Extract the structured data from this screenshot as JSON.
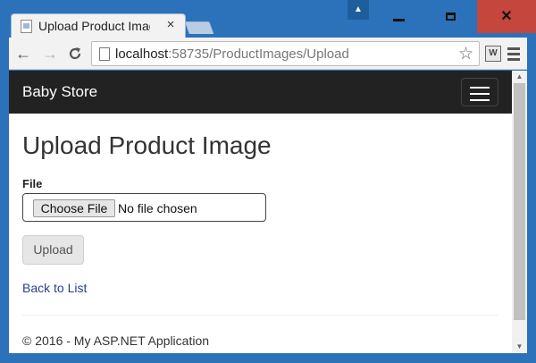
{
  "window": {
    "tab_title": "Upload Product Image",
    "tab_close": "×",
    "user_icon": "person-icon",
    "controls": {
      "minimize": "minimize-icon",
      "maximize": "maximize-icon",
      "close_glyph": "✕"
    }
  },
  "toolbar": {
    "back_glyph": "←",
    "forward_glyph": "→",
    "reload_glyph": "C",
    "url_host": "localhost",
    "url_path": ":58735/ProductImages/Upload",
    "star_glyph": "☆",
    "ext_label": "W"
  },
  "navbar": {
    "brand": "Baby Store"
  },
  "page": {
    "heading": "Upload Product Image",
    "file_label": "File",
    "choose_file": "Choose File",
    "no_file": "No file chosen",
    "upload": "Upload",
    "back_link": "Back to List",
    "footer": "© 2016 - My ASP.NET Application"
  },
  "scrollbar": {
    "up_glyph": "▲",
    "down_glyph": "▼"
  },
  "colors": {
    "window_frame": "#2b72bb",
    "close_button": "#c4463c",
    "navbar": "#222222",
    "link": "#2a3f8f"
  }
}
